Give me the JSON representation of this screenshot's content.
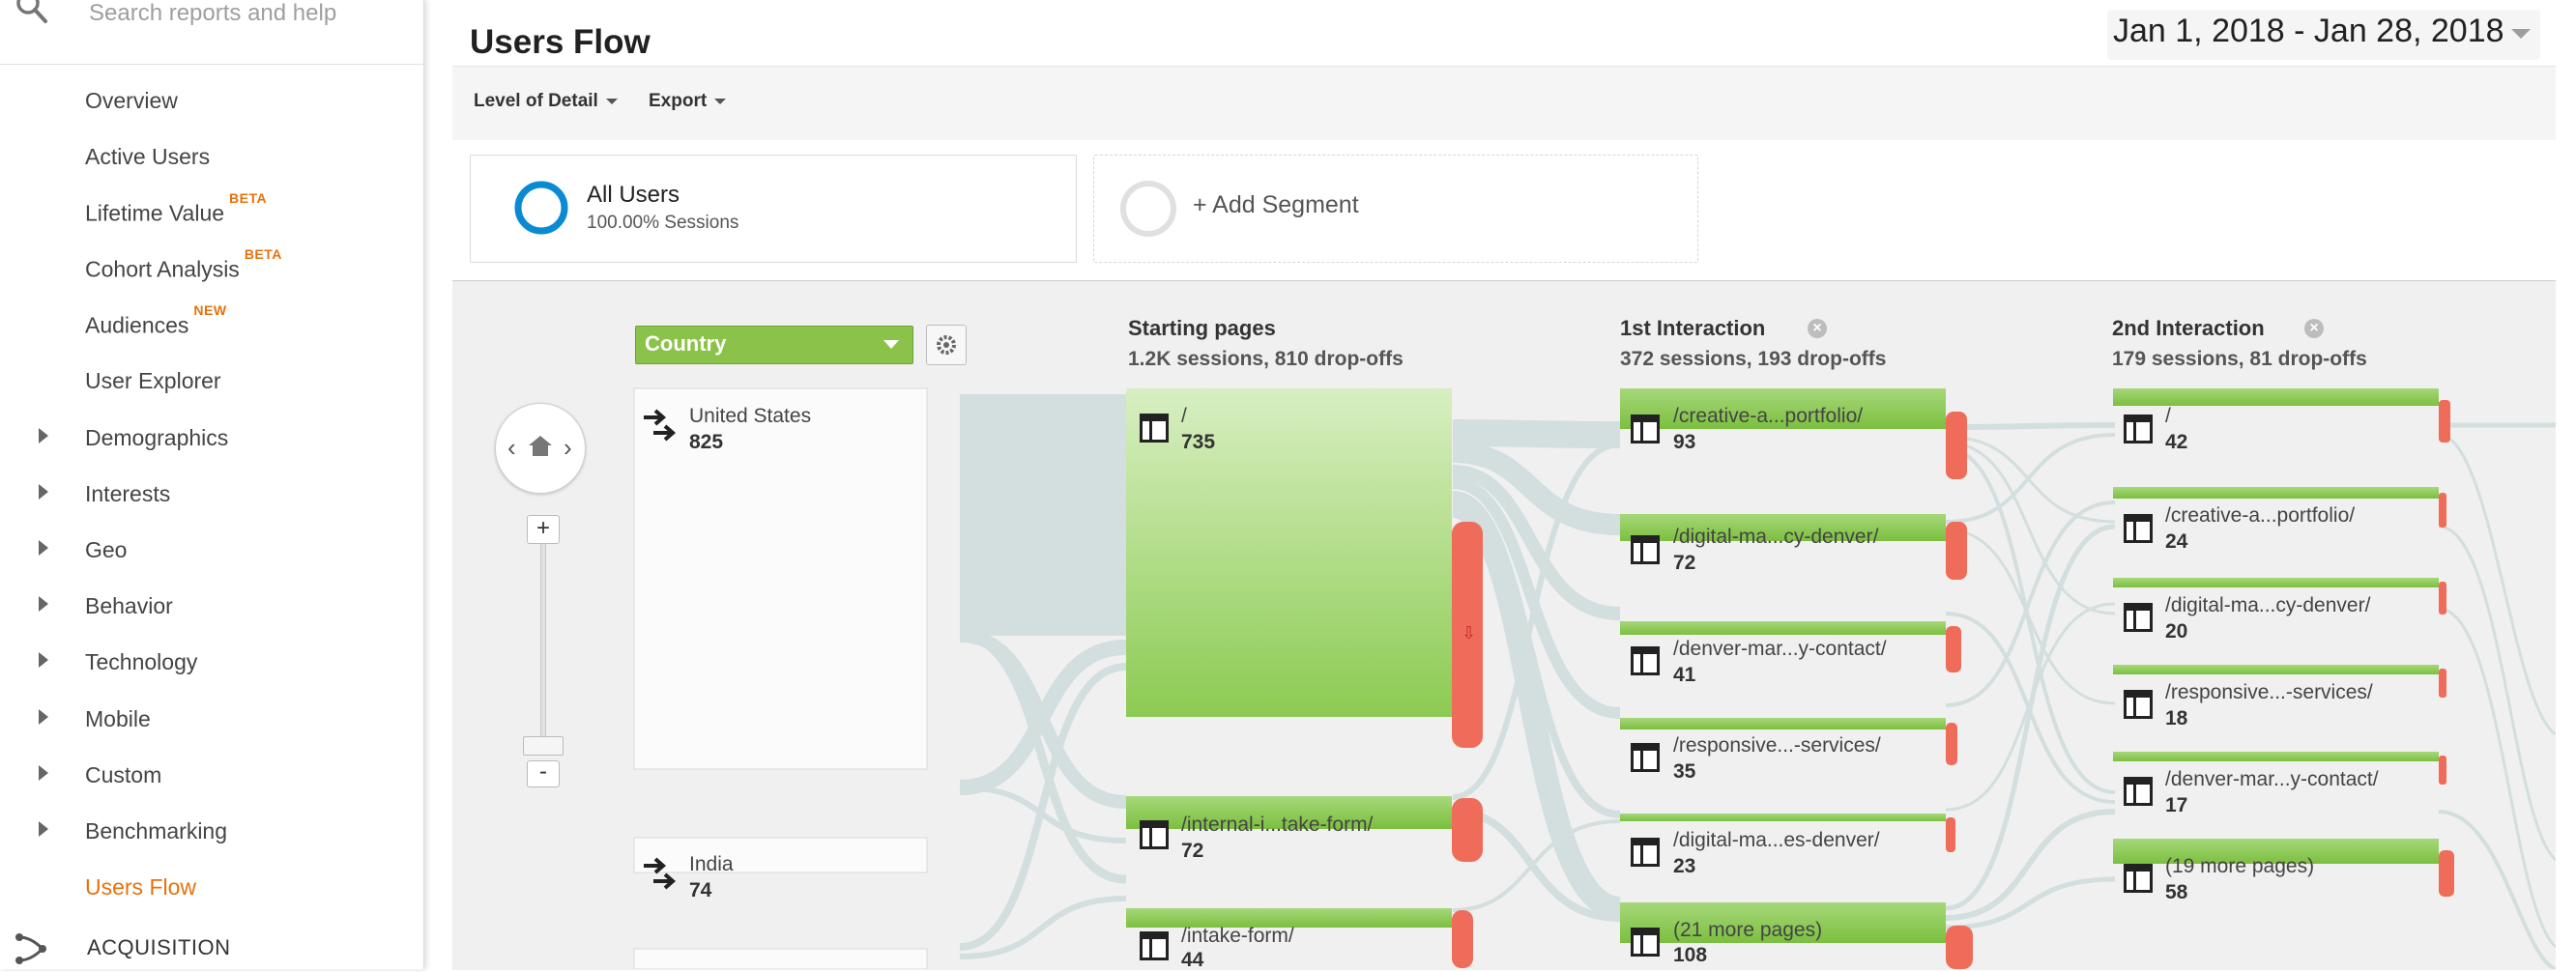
{
  "sidebar": {
    "search_placeholder": "Search reports and help",
    "items": [
      {
        "label": "Overview",
        "badge": "",
        "expandable": false,
        "active": false
      },
      {
        "label": "Active Users",
        "badge": "",
        "expandable": false,
        "active": false
      },
      {
        "label": "Lifetime Value",
        "badge": "BETA",
        "expandable": false,
        "active": false
      },
      {
        "label": "Cohort Analysis",
        "badge": "BETA",
        "expandable": false,
        "active": false
      },
      {
        "label": "Audiences",
        "badge": "NEW",
        "expandable": false,
        "active": false
      },
      {
        "label": "User Explorer",
        "badge": "",
        "expandable": false,
        "active": false
      },
      {
        "label": "Demographics",
        "badge": "",
        "expandable": true,
        "active": false
      },
      {
        "label": "Interests",
        "badge": "",
        "expandable": true,
        "active": false
      },
      {
        "label": "Geo",
        "badge": "",
        "expandable": true,
        "active": false
      },
      {
        "label": "Behavior",
        "badge": "",
        "expandable": true,
        "active": false
      },
      {
        "label": "Technology",
        "badge": "",
        "expandable": true,
        "active": false
      },
      {
        "label": "Mobile",
        "badge": "",
        "expandable": true,
        "active": false
      },
      {
        "label": "Custom",
        "badge": "",
        "expandable": true,
        "active": false
      },
      {
        "label": "Benchmarking",
        "badge": "",
        "expandable": true,
        "active": false
      },
      {
        "label": "Users Flow",
        "badge": "",
        "expandable": false,
        "active": true
      }
    ],
    "section": "ACQUISITION",
    "active_color": "#e8710a"
  },
  "header": {
    "title": "Users Flow",
    "date_range": "Jan 1, 2018 - Jan 28, 2018"
  },
  "toolbar": {
    "level_of_detail": "Level of Detail",
    "export": "Export"
  },
  "segments": {
    "all_users_name": "All Users",
    "all_users_sub": "100.00% Sessions",
    "add_segment": "+ Add Segment"
  },
  "flow": {
    "dimension_dropdown": "Country",
    "columns": [
      {
        "title": "Starting pages",
        "summary": "1.2K sessions, 810 drop-offs"
      },
      {
        "title": "1st Interaction",
        "summary": "372 sessions, 193 drop-offs"
      },
      {
        "title": "2nd Interaction",
        "summary": "179 sessions, 81 drop-offs"
      }
    ],
    "countries": [
      {
        "name": "United States",
        "count": "825"
      },
      {
        "name": "India",
        "count": "74"
      }
    ],
    "starting_pages": [
      {
        "page": "/",
        "count": "735"
      },
      {
        "page": "/internal-i...take-form/",
        "count": "72"
      },
      {
        "page": "/intake-form/",
        "count": "44"
      }
    ],
    "first_interaction": [
      {
        "page": "/creative-a...portfolio/",
        "count": "93"
      },
      {
        "page": "/digital-ma...cy-denver/",
        "count": "72"
      },
      {
        "page": "/denver-mar...y-contact/",
        "count": "41"
      },
      {
        "page": "/responsive...-services/",
        "count": "35"
      },
      {
        "page": "/digital-ma...es-denver/",
        "count": "23"
      },
      {
        "page": "(21 more pages)",
        "count": "108"
      }
    ],
    "second_interaction": [
      {
        "page": "/",
        "count": "42"
      },
      {
        "page": "/creative-a...portfolio/",
        "count": "24"
      },
      {
        "page": "/digital-ma...cy-denver/",
        "count": "20"
      },
      {
        "page": "/responsive...-services/",
        "count": "18"
      },
      {
        "page": "/denver-mar...y-contact/",
        "count": "17"
      },
      {
        "page": "(19 more pages)",
        "count": "58"
      }
    ],
    "colors": {
      "node_green": "#8bc34a",
      "dropoff_red": "#ef6c5a",
      "flow_gray": "#cfdcdc"
    }
  }
}
